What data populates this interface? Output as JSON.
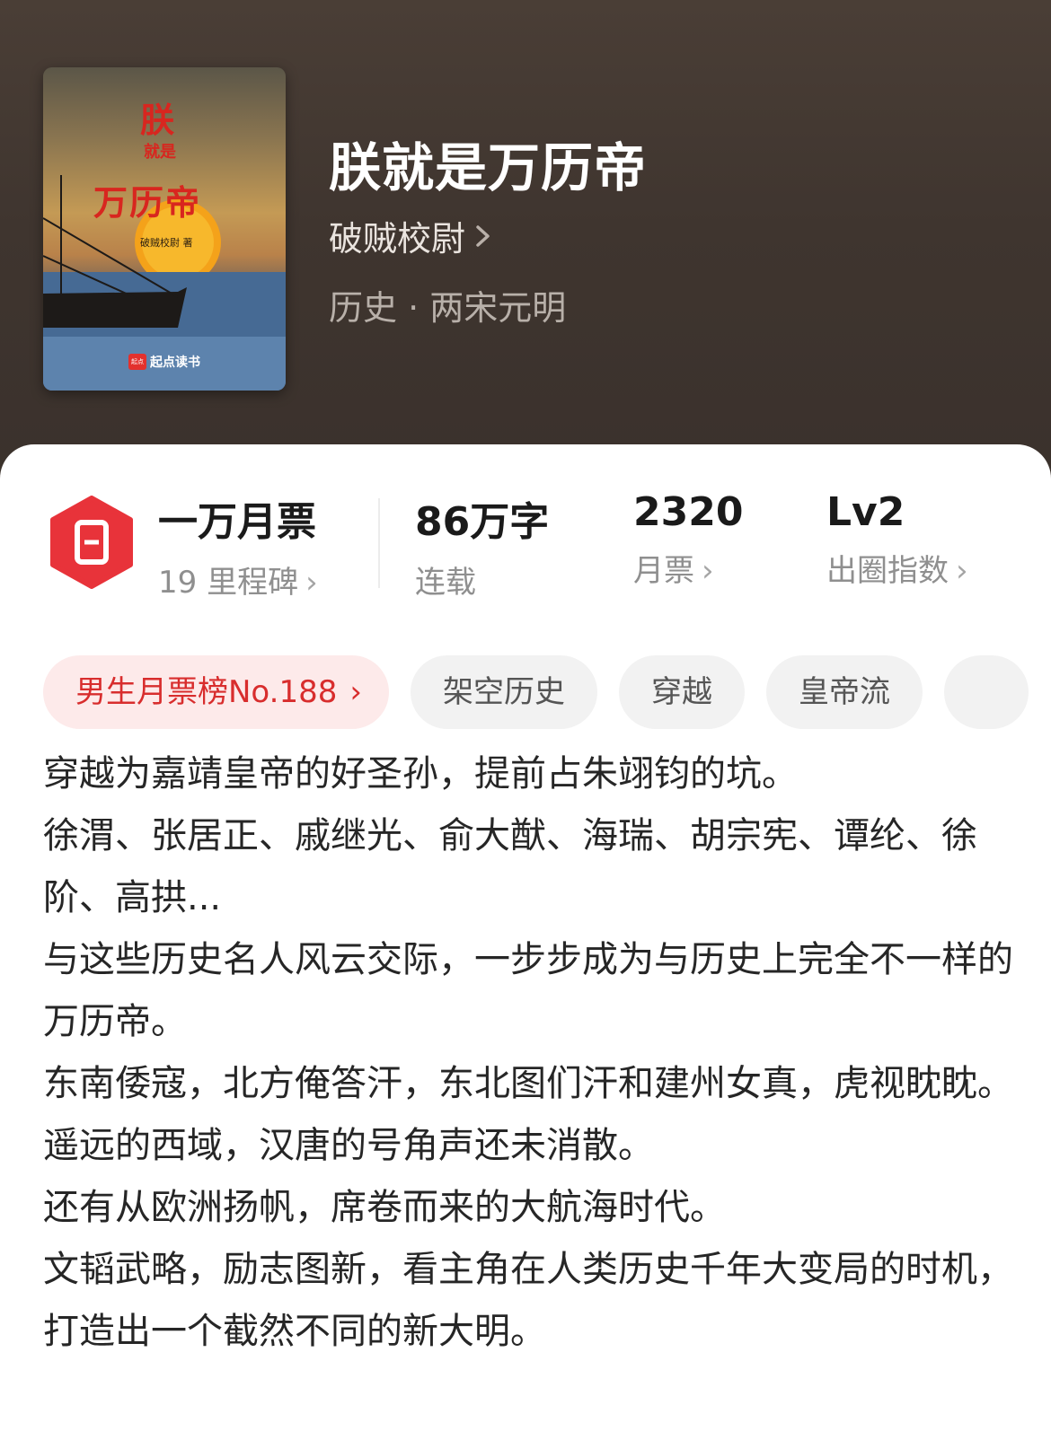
{
  "book": {
    "title": "朕就是万历帝",
    "author": "破贼校尉",
    "category": "历史 · 两宋元明",
    "cover": {
      "line1": "朕",
      "line2": "就是",
      "line3": "万历帝",
      "author": "破贼校尉 著",
      "brand": "起点读书",
      "brand_logo": "起点"
    }
  },
  "stats": {
    "milestone": {
      "main": "一万月票",
      "sub": "19 里程碑"
    },
    "words": {
      "main": "86万字",
      "sub": "连载"
    },
    "votes": {
      "main": "2320",
      "sub": "月票"
    },
    "level": {
      "main": "Lv2",
      "sub": "出圈指数"
    }
  },
  "tags": {
    "rank": "男生月票榜No.188",
    "items": [
      "架空历史",
      "穿越",
      "皇帝流"
    ]
  },
  "description": [
    "穿越为嘉靖皇帝的好圣孙，提前占朱翊钧的坑。",
    "徐渭、张居正、戚继光、俞大猷、海瑞、胡宗宪、谭纶、徐阶、高拱...",
    "与这些历史名人风云交际，一步步成为与历史上完全不一样的万历帝。",
    "东南倭寇，北方俺答汗，东北图们汗和建州女真，虎视眈眈。",
    "遥远的西域，汉唐的号角声还未消散。",
    "还有从欧洲扬帆，席卷而来的大航海时代。",
    "文韬武略，励志图新，看主角在人类历史千年大变局的时机，打造出一个截然不同的新大明。"
  ],
  "colors": {
    "header_bg": "#3f352f",
    "accent_red": "#e8333a",
    "rank_bg": "#fdeaea"
  },
  "icons": {
    "milestone": "ticket-hexagon-icon",
    "chevron": "chevron-right-icon"
  }
}
